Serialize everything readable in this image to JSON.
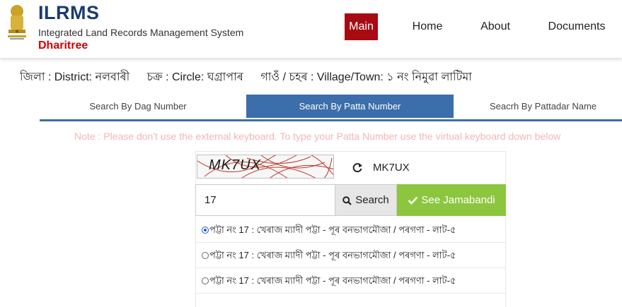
{
  "header": {
    "title": "ILRMS",
    "subtitle": "Integrated Land Records Management System",
    "brand": "Dharitree",
    "nav": {
      "main": "Main",
      "home": "Home",
      "about": "About",
      "documents": "Documents"
    },
    "active_color": "#a80a12"
  },
  "location": {
    "district": "জিলা : District: নলবাৰী",
    "circle": "চক্ৰ : Circle: ঘগ্ৰাপাৰ",
    "village": "গাওঁ / চহৰ : Village/Town: ১ নং নিমুৱা লাটিমা"
  },
  "tabs": [
    {
      "label": "Search By Dag Number",
      "active": false
    },
    {
      "label": "Search By Patta Number",
      "active": true
    },
    {
      "label": "Seacrh By Pattadar Name",
      "active": false
    }
  ],
  "note": "Note : Please don't use the external keyboard. To type your Patta Number use the virtual keyboard down below",
  "form": {
    "captcha_image_text": "MK7UX",
    "captcha_value": "MK7UX",
    "patta_value": "17",
    "search_label": "Search",
    "jamabandi_label": "See Jamabandi",
    "accent_color": "#8cc63f"
  },
  "results": [
    {
      "label": "পট্টা নং 17 : খেৰাজ ম্যাদী পট্টা - পূৰ বনভাগমৌজা / পৰগণা - লাট-৫",
      "selected": true
    },
    {
      "label": "পট্টা নং 17 : খেৰাজ ম্যাদী পট্টা - পূৰ বনভাগমৌজা / পৰগণা - লাট-৫",
      "selected": false
    },
    {
      "label": "পট্টা নং 17 : খেৰাজ ম্যাদী পট্টা - পূৰ বনভাগমৌজা / পৰগণা - লাট-৫",
      "selected": false
    }
  ]
}
